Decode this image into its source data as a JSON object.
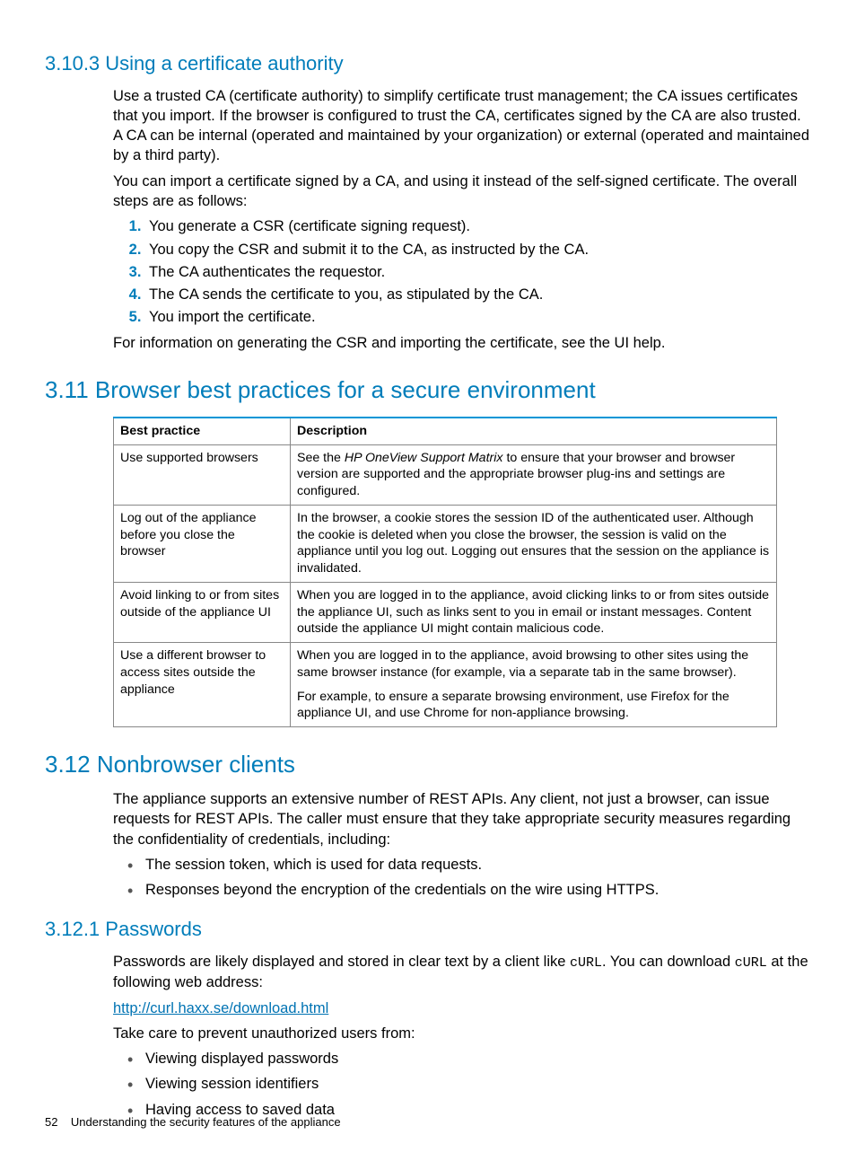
{
  "sec_3_10_3": {
    "heading": "3.10.3 Using a certificate authority",
    "para1": "Use a trusted CA (certificate authority) to simplify certificate trust management; the CA issues certificates that you import. If the browser is configured to trust the CA, certificates signed by the CA are also trusted. A CA can be internal (operated and maintained by your organization) or external (operated and maintained by a third party).",
    "para2": "You can import a certificate signed by a CA, and using it instead of the self-signed certificate. The overall steps are as follows:",
    "steps": [
      "You generate a CSR (certificate signing request).",
      "You copy the CSR and submit it to the CA, as instructed by the CA.",
      "The CA authenticates the requestor.",
      "The CA sends the certificate to you, as stipulated by the CA.",
      "You import the certificate."
    ],
    "para3": "For information on generating the CSR and importing the certificate, see the UI help."
  },
  "sec_3_11": {
    "heading": "3.11 Browser best practices for a secure environment",
    "table": {
      "headers": [
        "Best practice",
        "Description"
      ],
      "rows": [
        {
          "practice": "Use supported browsers",
          "desc_pre": "See the ",
          "desc_italic": "HP OneView Support Matrix",
          "desc_post": " to ensure that your browser and browser version are supported and the appropriate browser plug-ins and settings are configured."
        },
        {
          "practice": "Log out of the appliance before you close the browser",
          "desc": "In the browser, a cookie stores the session ID of the authenticated user. Although the cookie is deleted when you close the browser, the session is valid on the appliance until you log out. Logging out ensures that the session on the appliance is invalidated."
        },
        {
          "practice": "Avoid linking to or from sites outside of the appliance UI",
          "desc": "When you are logged in to the appliance, avoid clicking links to or from sites outside the appliance UI, such as links sent to you in email or instant messages. Content outside the appliance UI might contain malicious code."
        },
        {
          "practice": "Use a different browser to access sites outside the appliance",
          "desc_p1": "When you are logged in to the appliance, avoid browsing to other sites using the same browser instance (for example, via a separate tab in the same browser).",
          "desc_p2": "For example, to ensure a separate browsing environment, use Firefox for the appliance UI, and use Chrome for non-appliance browsing."
        }
      ]
    }
  },
  "sec_3_12": {
    "heading": "3.12 Nonbrowser clients",
    "para1": "The appliance supports an extensive number of REST APIs. Any client, not just a browser, can issue requests for REST APIs. The caller must ensure that they take appropriate security measures regarding the confidentiality of credentials, including:",
    "bullets": [
      "The session token, which is used for data requests.",
      "Responses beyond the encryption of the credentials on the wire using HTTPS."
    ]
  },
  "sec_3_12_1": {
    "heading": "3.12.1 Passwords",
    "para1_pre": "Passwords are likely displayed and stored in clear text by a client like ",
    "para1_code1": "cURL",
    "para1_mid": ". You can download ",
    "para1_code2": "cURL",
    "para1_post": " at the following web address:",
    "link": "http://curl.haxx.se/download.html",
    "para2": "Take care to prevent unauthorized users from:",
    "bullets": [
      "Viewing displayed passwords",
      "Viewing session identifiers",
      "Having access to saved data"
    ]
  },
  "footer": {
    "page": "52",
    "title": "Understanding the security features of the appliance"
  }
}
